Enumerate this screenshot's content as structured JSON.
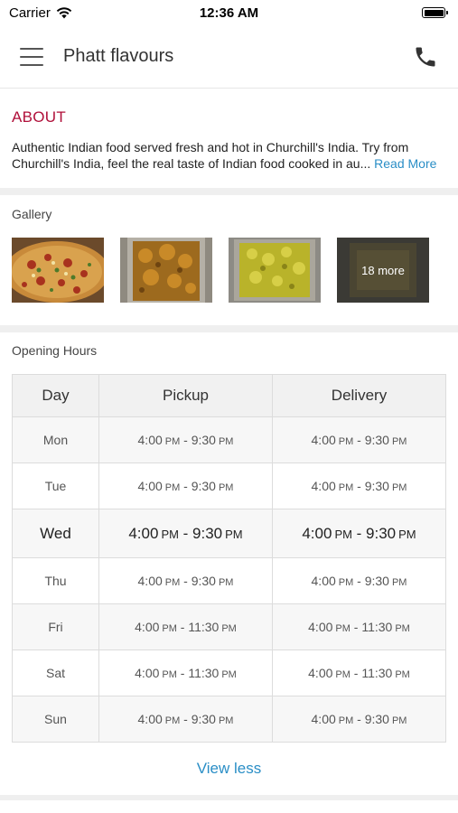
{
  "status": {
    "carrier": "Carrier",
    "time": "12:36 AM"
  },
  "nav": {
    "title": "Phatt flavours"
  },
  "about": {
    "title": "ABOUT",
    "line1": "Authentic Indian food served fresh and hot in Churchill's India. Try from",
    "line2": "Churchill's India, feel the real taste of Indian food cooked in au...",
    "read_more": "Read More"
  },
  "gallery": {
    "label": "Gallery",
    "more_label": "18 more"
  },
  "hours": {
    "label": "Opening Hours",
    "headers": {
      "day": "Day",
      "pickup": "Pickup",
      "delivery": "Delivery"
    },
    "rows": [
      {
        "day": "Mon",
        "pickup_start": "4:00",
        "pickup_end": "9:30",
        "delivery_start": "4:00",
        "delivery_end": "9:30"
      },
      {
        "day": "Tue",
        "pickup_start": "4:00",
        "pickup_end": "9:30",
        "delivery_start": "4:00",
        "delivery_end": "9:30"
      },
      {
        "day": "Wed",
        "pickup_start": "4:00",
        "pickup_end": "9:30",
        "delivery_start": "4:00",
        "delivery_end": "9:30"
      },
      {
        "day": "Thu",
        "pickup_start": "4:00",
        "pickup_end": "9:30",
        "delivery_start": "4:00",
        "delivery_end": "9:30"
      },
      {
        "day": "Fri",
        "pickup_start": "4:00",
        "pickup_end": "11:30",
        "delivery_start": "4:00",
        "delivery_end": "11:30"
      },
      {
        "day": "Sat",
        "pickup_start": "4:00",
        "pickup_end": "11:30",
        "delivery_start": "4:00",
        "delivery_end": "11:30"
      },
      {
        "day": "Sun",
        "pickup_start": "4:00",
        "pickup_end": "9:30",
        "delivery_start": "4:00",
        "delivery_end": "9:30"
      }
    ],
    "pm": "PM",
    "view_less": "View less"
  },
  "colors": {
    "accent": "#b0103a",
    "link": "#2a8ec6"
  }
}
